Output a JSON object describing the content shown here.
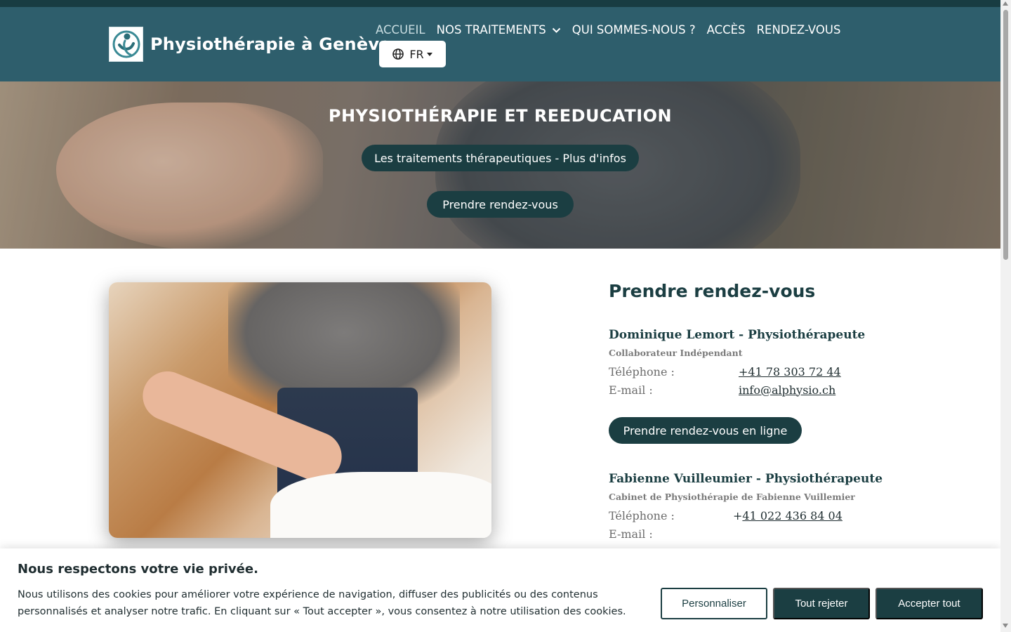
{
  "header": {
    "brand_name": "Physiothérapie à Genève",
    "logo_icon": "physio-figure-logo"
  },
  "nav": {
    "items": [
      {
        "label": "ACCUEIL",
        "active": true
      },
      {
        "label": "NOS TRAITEMENTS",
        "dropdown": true
      },
      {
        "label": "QUI SOMMES-NOUS ?"
      },
      {
        "label": "ACCÈS"
      },
      {
        "label": "RENDEZ-VOUS"
      }
    ],
    "language": "FR",
    "language_icon": "globe-icon"
  },
  "hero": {
    "title": "PHYSIOTHÉRAPIE ET REEDUCATION",
    "button_treatments": "Les traitements thérapeutiques - Plus d'infos",
    "button_appointment": "Prendre rendez-vous"
  },
  "appointment": {
    "title": "Prendre rendez-vous",
    "practitioners": [
      {
        "name": "Dominique Lemort - Physiothérapeute",
        "role": "Collaborateur Indépendant",
        "phone_label": "Téléphone :",
        "phone": "+41 78 303 72 44",
        "email_label": "E-mail :",
        "email": "info@alphysio.ch",
        "button": "Prendre rendez-vous en ligne"
      },
      {
        "name": "Fabienne Vuilleumier - Physiothérapeute",
        "role": "Cabinet de Physiothérapie de Fabienne Vuillemier",
        "phone_label": "Téléphone :",
        "phone_prefix": "+",
        "phone": "41 022 436 84 04",
        "email_label": "E-mail :"
      }
    ]
  },
  "cookie_banner": {
    "title": "Nous respectons votre vie privée.",
    "text": "Nous utilisons des cookies pour améliorer votre expérience de navigation, diffuser des publicités ou des contenus personnalisés et analyser notre trafic. En cliquant sur « Tout accepter », vous consentez à notre utilisation des cookies.",
    "customize": "Personnaliser",
    "reject": "Tout rejeter",
    "accept": "Accepter tout"
  },
  "colors": {
    "navbar": "#2e5e6c",
    "topstrip": "#183c42",
    "accent": "#1b3e42"
  }
}
